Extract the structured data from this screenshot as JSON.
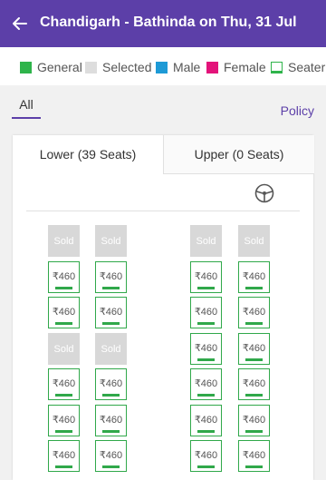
{
  "header": {
    "title": "Chandigarh - Bathinda on Thu, 31 Jul"
  },
  "legend": [
    {
      "label": "General",
      "color": "#2fb44b",
      "style": "filled"
    },
    {
      "label": "Selected",
      "color": "#dddddd",
      "style": "filled"
    },
    {
      "label": "Male",
      "color": "#1e9ad6",
      "style": "filled"
    },
    {
      "label": "Female",
      "color": "#e3137a",
      "style": "filled"
    },
    {
      "label": "Seater",
      "color": "#2fb44b",
      "style": "outline"
    }
  ],
  "tabs": {
    "all": "All",
    "policy": "Policy"
  },
  "decks": {
    "lower": "Lower (39 Seats)",
    "upper": "Upper (0 Seats)"
  },
  "seat": {
    "price": "₹460",
    "sold_label": "Sold"
  },
  "seat_grid": [
    [
      "sold",
      "sold",
      "sold",
      "sold"
    ],
    [
      "avail",
      "avail",
      "avail",
      "avail"
    ],
    [
      "avail",
      "avail",
      "avail",
      "avail"
    ],
    [
      "sold",
      "sold",
      "avail",
      "avail"
    ],
    [
      "avail",
      "avail",
      "avail",
      "avail"
    ],
    [
      "avail",
      "avail",
      "avail",
      "avail"
    ],
    [
      "avail",
      "avail",
      "avail",
      "avail"
    ]
  ]
}
